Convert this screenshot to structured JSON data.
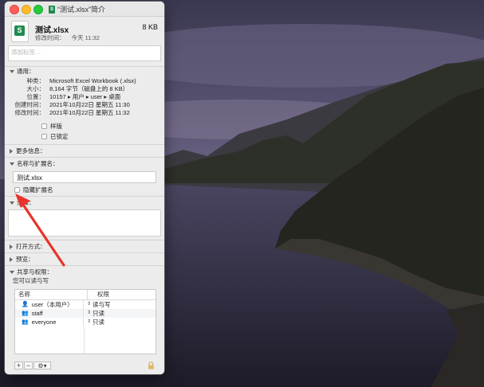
{
  "window": {
    "title": "“测试.xlsx”简介",
    "file_icon_label": "S",
    "file_name": "测试.xlsx",
    "file_size": "8 KB",
    "modified_label": "修改时间：",
    "modified_value": "今天 11:32",
    "tags_placeholder": "添加标签…"
  },
  "general": {
    "header": "通用：",
    "rows": [
      {
        "k": "种类：",
        "v": "Microsoft Excel Workbook (.xlsx)"
      },
      {
        "k": "大小：",
        "v": "8,164 字节（磁盘上的 8 KB）"
      },
      {
        "k": "位置：",
        "v": "10157 ▸ 用户 ▸ user ▸ 桌面"
      },
      {
        "k": "创建时间：",
        "v": "2021年10月22日 星期五 11:30"
      },
      {
        "k": "修改时间：",
        "v": "2021年10月22日 星期五 11:32"
      }
    ],
    "stationery_label": "样版",
    "locked_label": "已锁定"
  },
  "more_info": {
    "header": "更多信息："
  },
  "name_ext": {
    "header": "名称与扩展名：",
    "name_value": "测试.xlsx",
    "hide_ext_label": "隐藏扩展名"
  },
  "comments": {
    "header": "注释："
  },
  "open_with": {
    "header": "打开方式："
  },
  "preview": {
    "header": "预览："
  },
  "sharing": {
    "header": "共享与权限：",
    "subtitle": "您可以读与写",
    "col_name": "名称",
    "col_priv": "权限",
    "rows": [
      {
        "name": "user（本用户）",
        "priv": "读与写",
        "icon": "user-icon"
      },
      {
        "name": "staff",
        "priv": "只读",
        "icon": "group-icon"
      },
      {
        "name": "everyone",
        "priv": "只读",
        "icon": "group-icon"
      }
    ],
    "add": "+",
    "remove": "−"
  },
  "colors": {
    "excel_green": "#1e8b4e",
    "arrow_red": "#e8322b"
  }
}
